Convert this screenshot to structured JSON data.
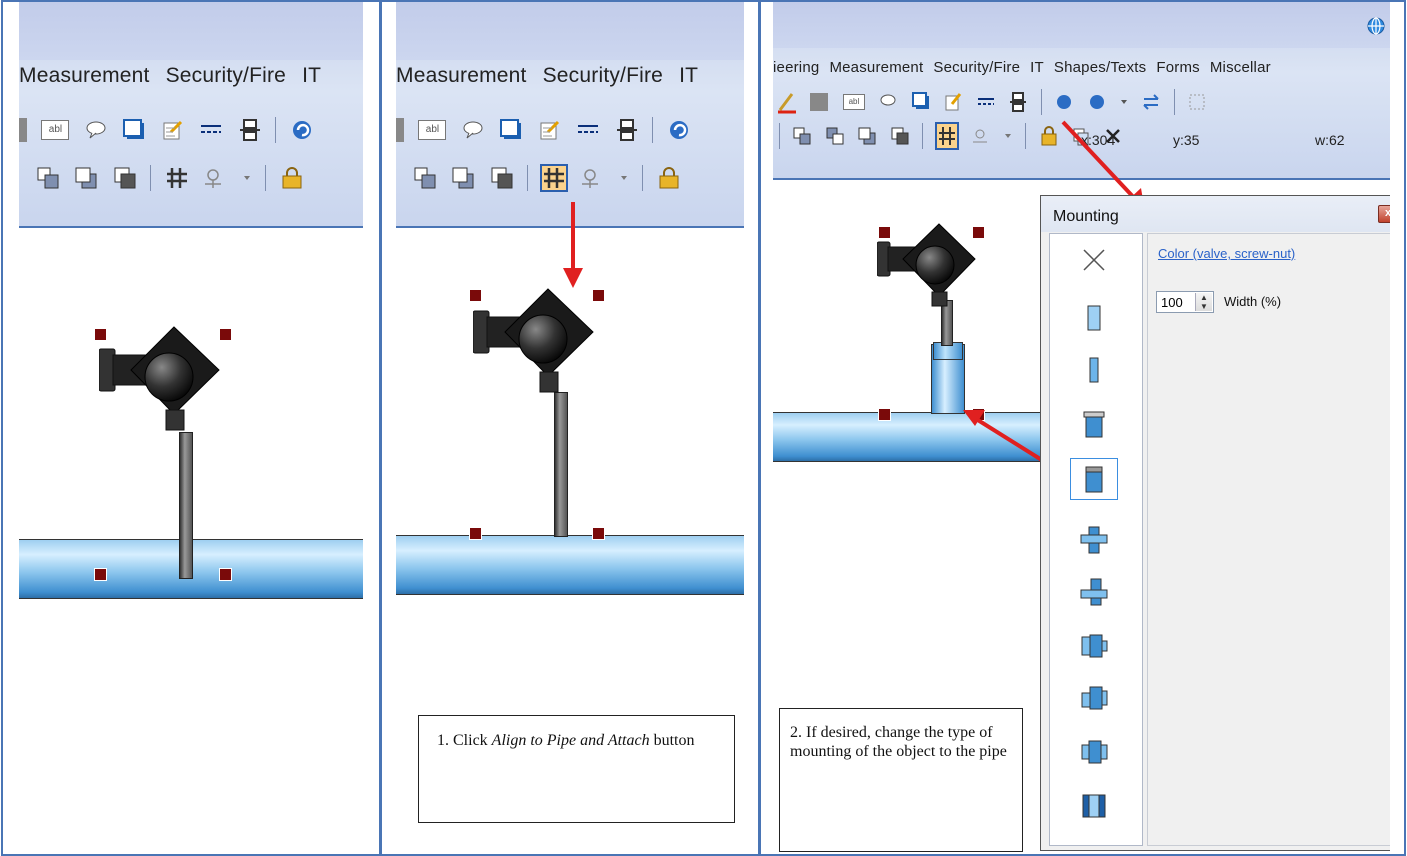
{
  "menu_items": [
    "Measurement",
    "Security/Fire",
    "IT"
  ],
  "panel3_menu_items": [
    "ieering",
    "Measurement",
    "Security/Fire",
    "IT",
    "Shapes/Texts",
    "Forms",
    "Miscellar"
  ],
  "toolbar_label": "abl",
  "coords": {
    "x": "x:304",
    "y": "y:35",
    "w": "w:62"
  },
  "caption1": {
    "prefix": "1. Click ",
    "italic": "Align to Pipe and Attach",
    "suffix": " button"
  },
  "caption2": "2. If desired, change the type of mounting of the object to the pipe",
  "dialog": {
    "title": "Mounting",
    "close": "x",
    "color_link": "Color (valve, screw-nut)",
    "width_value": "100",
    "width_label": "Width (%)",
    "mount_types": [
      "none-icon",
      "plain-icon",
      "slim-icon",
      "flange-icon",
      "flange-selected-icon",
      "tee-icon",
      "tee-offset-icon",
      "valve-left-icon",
      "valve-right-icon",
      "valve-both-icon",
      "sleeve-icon"
    ],
    "selected_index": 4
  },
  "colors": {
    "accent": "#4a75b5",
    "arrow": "#e02020",
    "handle": "#7a0a0a",
    "pipe": "#8ec7ee"
  }
}
